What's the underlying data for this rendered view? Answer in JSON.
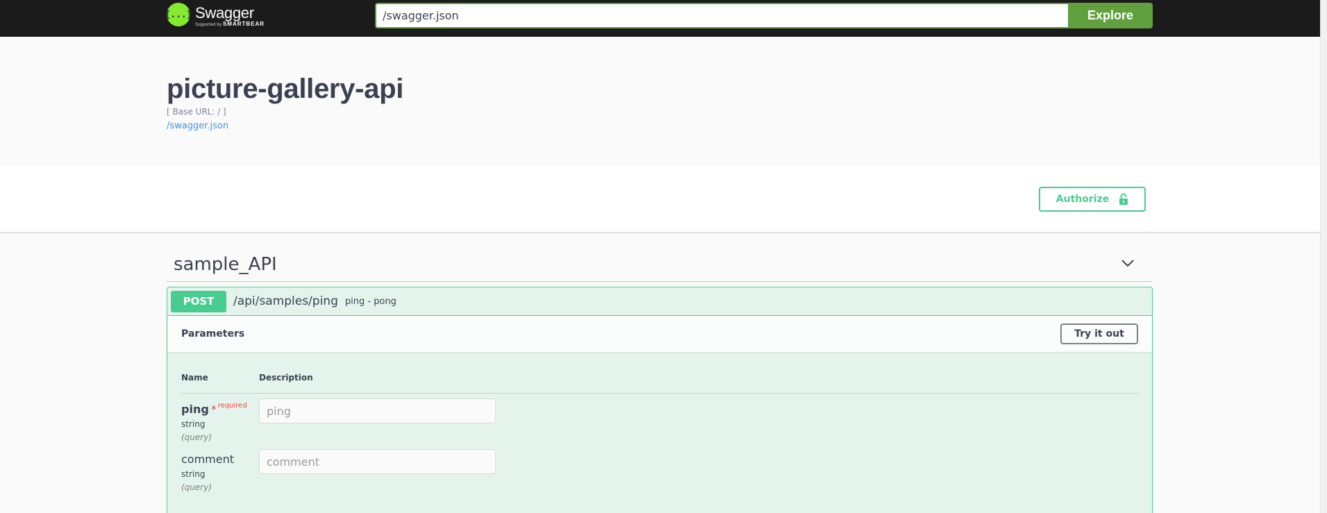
{
  "topbar": {
    "brand_name": "Swagger",
    "brand_sub_prefix": "Supported by",
    "brand_sub_company": "SMARTBEAR",
    "logo_glyph": "{...}",
    "url_value": "/swagger.json",
    "explore_label": "Explore"
  },
  "info": {
    "title": "picture-gallery-api",
    "base_url": "[ Base URL: / ]",
    "spec_link": "/swagger.json"
  },
  "auth": {
    "authorize_label": "Authorize",
    "icon": "lock-icon"
  },
  "tag": {
    "name": "sample_API",
    "icon": "chevron-down-icon"
  },
  "operation": {
    "method": "POST",
    "path": "/api/samples/ping",
    "summary": "ping - pong",
    "parameters_title": "Parameters",
    "try_label": "Try it out",
    "columns": {
      "name": "Name",
      "description": "Description"
    },
    "params": [
      {
        "name": "ping",
        "required_star": "*",
        "required_label": "required",
        "type": "string",
        "in": "(query)",
        "placeholder": "ping"
      },
      {
        "name": "comment",
        "type": "string",
        "in": "(query)",
        "placeholder": "comment"
      }
    ]
  },
  "colors": {
    "topbar_bg": "#1b1b1b",
    "explore_green": "#62a03f",
    "post_green": "#49cc90",
    "link_blue": "#4990e2",
    "required_red": "#f93e3e"
  }
}
